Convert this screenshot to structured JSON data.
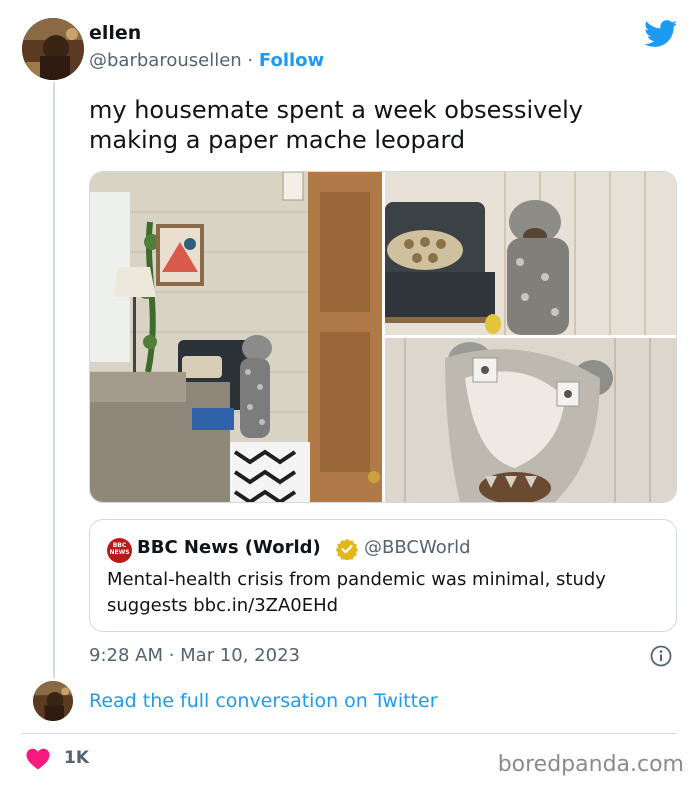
{
  "tweet": {
    "author_name": "ellen",
    "author_handle": "@barbarousellen",
    "separator": "·",
    "follow_label": "Follow",
    "text": "my housemate spent a week obsessively making a paper mache leopard",
    "timestamp": "9:28 AM · Mar 10, 2023"
  },
  "quote": {
    "logo_text": "BBC NEWS",
    "name": "BBC News (World)",
    "handle": "@BBCWorld",
    "text": "Mental-health crisis from pandemic was minimal, study suggests bbc.in/3ZA0EHd"
  },
  "conversation": {
    "read_label": "Read the full conversation on Twitter"
  },
  "footer": {
    "like_count": "1K",
    "watermark": "boredpanda.com"
  },
  "icons": {
    "brand": "twitter-bird-icon",
    "verified": "verified-gold-badge-icon",
    "info": "info-icon",
    "like": "heart-icon"
  },
  "colors": {
    "accent": "#1d9bf0",
    "heart": "#f91880",
    "verified_gold": "#e2b719",
    "bbc_red": "#bb1919",
    "muted_text": "#536471",
    "border": "#cfd9de"
  }
}
